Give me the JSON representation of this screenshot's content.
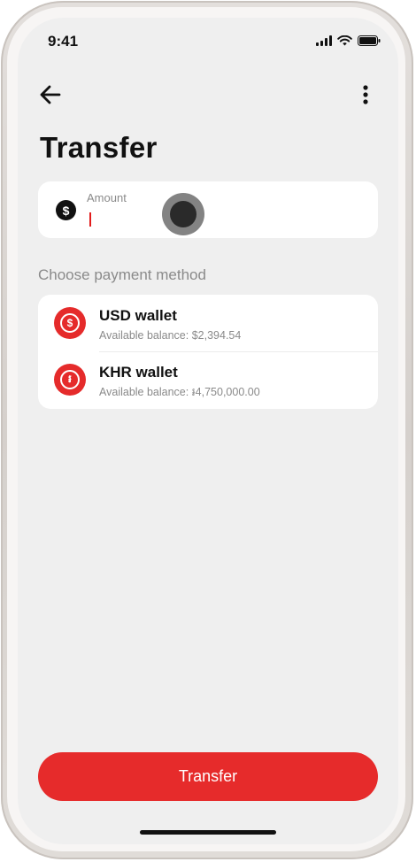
{
  "status_bar": {
    "time": "9:41"
  },
  "header": {
    "back_icon": "arrow-left-icon",
    "more_icon": "more-vertical-icon",
    "title": "Transfer"
  },
  "amount_field": {
    "icon": "dollar-circle-icon",
    "label": "Amount",
    "value": "",
    "placeholder": ""
  },
  "payment_section": {
    "label": "Choose payment method",
    "methods": [
      {
        "name": "USD wallet",
        "balance": "Available balance: $2,394.54",
        "icon": "dollar-wallet-icon",
        "symbol": "$"
      },
      {
        "name": "KHR wallet",
        "balance": "Available balance: ៛4,750,000.00",
        "icon": "riel-wallet-icon",
        "symbol": "៛"
      }
    ]
  },
  "footer": {
    "transfer_label": "Transfer"
  },
  "colors": {
    "accent": "#e62b2b",
    "background": "#efefef",
    "card": "#ffffff",
    "text_primary": "#111111",
    "text_secondary": "#8a8a8a"
  }
}
